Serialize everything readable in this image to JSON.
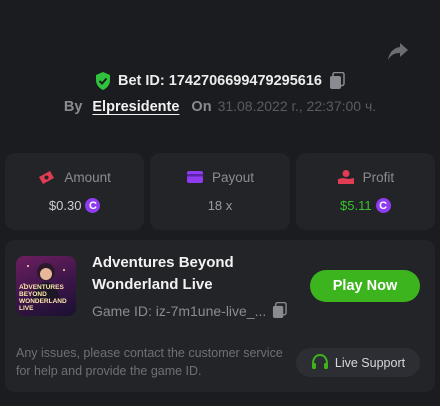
{
  "share": {
    "icon": "share-arrow-icon"
  },
  "bet": {
    "label_id": "Bet ID: 1742706699479295616",
    "shield_icon": "shield-check-icon",
    "shield_color": "#2fc23c",
    "copy_icon": "copy-icon"
  },
  "meta": {
    "by_label": "By",
    "author": "Elpresidente",
    "on_label": "On",
    "date": "31.08.2022 г., 22:37:00 ч."
  },
  "stats": [
    {
      "label": "Amount",
      "icon": "money-icon",
      "icon_color": "#e23b54",
      "value": "$0.30",
      "value_color": "#cfcfd3",
      "coin": "C"
    },
    {
      "label": "Payout",
      "icon": "credit-card-icon",
      "icon_color": "#8f3cf0",
      "value": "18 x",
      "value_color": "#9a9ba0",
      "coin": ""
    },
    {
      "label": "Profit",
      "icon": "hand-coin-icon",
      "icon_color": "#e23b54",
      "value": "$5.11",
      "value_color": "#36c42a",
      "coin": "C"
    }
  ],
  "game": {
    "thumb_text": "ADVENTURES BEYOND WONDERLAND LIVE",
    "title_line1": "Adventures Beyond",
    "title_line2": "Wonderland Live",
    "game_id": "Game ID: iz-7m1une-live_...",
    "copy_icon": "copy-icon",
    "play_label": "Play Now",
    "play_color": "#3cb41e"
  },
  "support": {
    "issues_text": "Any issues, please contact the customer service for help and provide the game ID.",
    "button_label": "Live Support",
    "icon": "headset-icon",
    "icon_color": "#3cb41e"
  }
}
